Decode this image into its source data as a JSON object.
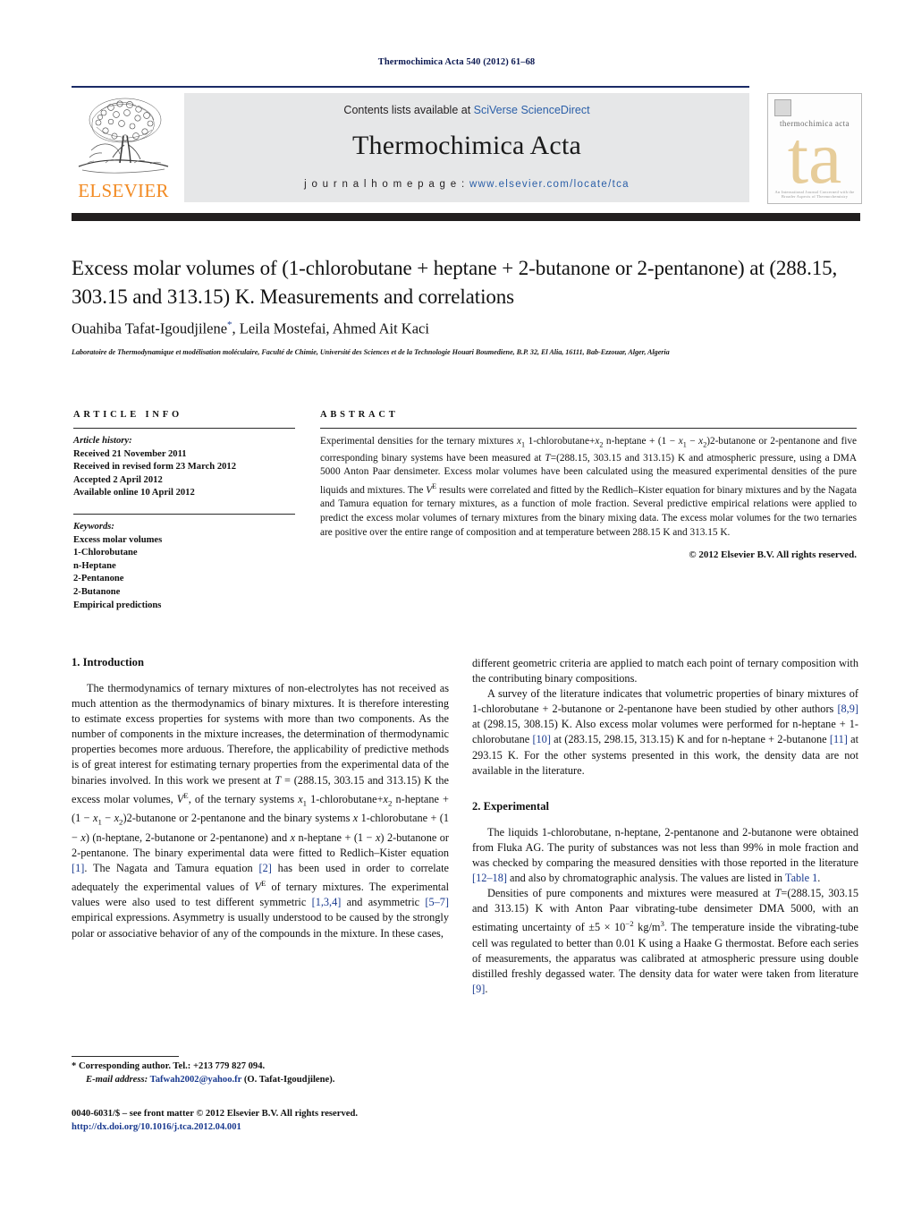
{
  "running_head": "Thermochimica Acta 540 (2012) 61–68",
  "masthead": {
    "contents_prefix": "Contents lists available at ",
    "contents_link": "SciVerse ScienceDirect",
    "journal_name": "Thermochimica Acta",
    "homepage_label": "j o u r n a l   h o m e p a g e :   ",
    "homepage_url": "www.elsevier.com/locate/tca",
    "publisher_logo_text": "ELSEVIER",
    "cover_title": "thermochimica acta",
    "cover_monogram": "ta",
    "cover_footer": "An International Journal Concerned with the Broader Aspects of Thermochemistry"
  },
  "article": {
    "title": "Excess molar volumes of (1-chlorobutane + heptane + 2-butanone or 2-pentanone) at (288.15, 303.15 and 313.15) K. Measurements and correlations",
    "authors": "Ouahiba Tafat-Igoudjilene",
    "authors_rest": ", Leila Mostefai, Ahmed Ait Kaci",
    "affiliation": "Laboratoire de Thermodynamique et modélisation moléculaire, Faculté de Chimie, Université des Sciences et de la Technologie Houari Boumediene, B.P. 32, El Alia, 16111, Bab-Ezzouar, Alger, Algeria"
  },
  "article_info": {
    "heading": "ARTICLE INFO",
    "history_label": "Article history:",
    "history": [
      "Received 21 November 2011",
      "Received in revised form 23 March 2012",
      "Accepted 2 April 2012",
      "Available online 10 April 2012"
    ],
    "keywords_label": "Keywords:",
    "keywords": [
      "Excess molar volumes",
      "1-Chlorobutane",
      "n-Heptane",
      "2-Pentanone",
      "2-Butanone",
      "Empirical predictions"
    ]
  },
  "abstract": {
    "heading": "ABSTRACT",
    "copyright": "© 2012 Elsevier B.V. All rights reserved."
  },
  "sections": {
    "introduction_heading": "1.  Introduction",
    "experimental_heading": "2.  Experimental"
  },
  "footnotes": {
    "corresponding": "* Corresponding author. Tel.: +213 779 827 094.",
    "email_label": "E-mail address:",
    "email": "Tafwah2002@yahoo.fr",
    "email_owner": "(O. Tafat-Igoudjilene).",
    "issn_line": "0040-6031/$ – see front matter © 2012 Elsevier B.V. All rights reserved.",
    "doi": "http://dx.doi.org/10.1016/j.tca.2012.04.001"
  }
}
